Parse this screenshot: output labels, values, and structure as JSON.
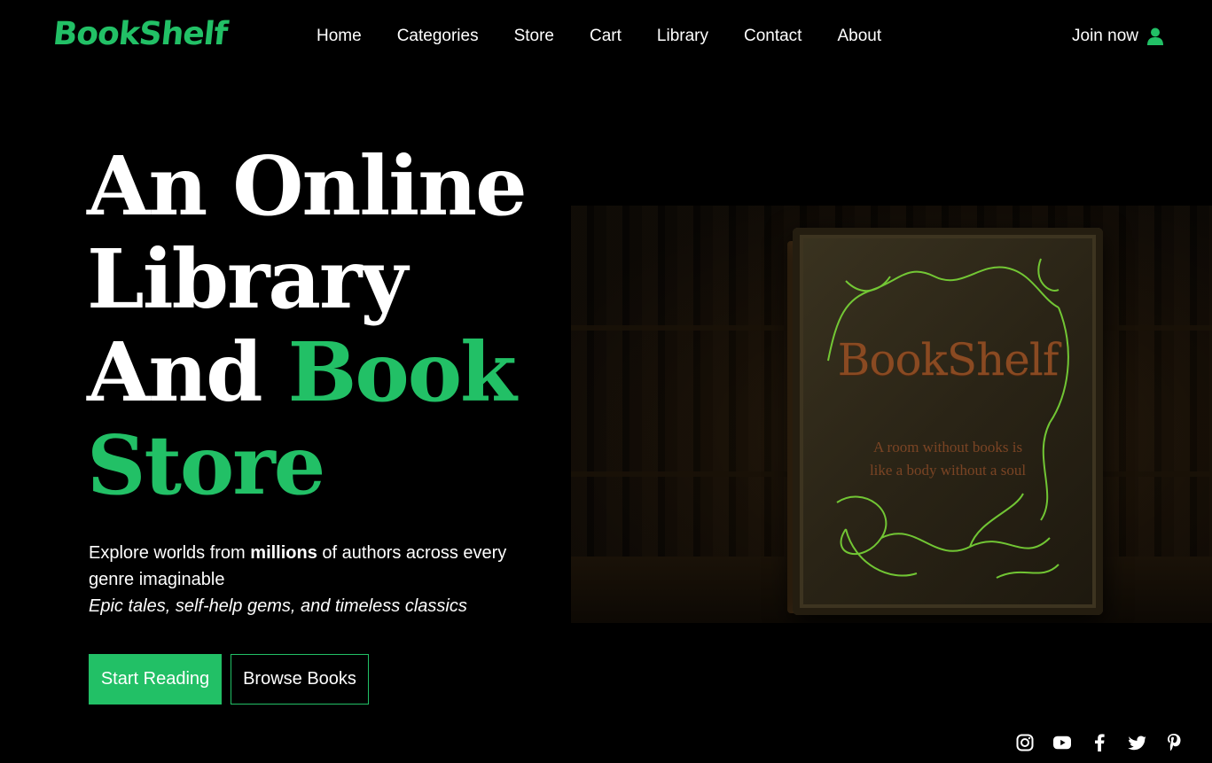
{
  "brand": {
    "name": "BookShelf",
    "accent_color": "#22c066"
  },
  "nav": {
    "items": [
      {
        "label": "Home"
      },
      {
        "label": "Categories"
      },
      {
        "label": "Store"
      },
      {
        "label": "Cart"
      },
      {
        "label": "Library"
      },
      {
        "label": "Contact"
      },
      {
        "label": "About"
      }
    ],
    "join_label": "Join now",
    "join_icon": "user-icon"
  },
  "hero": {
    "headline_line1": "An Online",
    "headline_line2": "Library",
    "headline_line3_white": "And ",
    "headline_line3_green": "Book",
    "headline_line4_green": "Store",
    "desc_prefix": "Explore worlds from ",
    "desc_bold": "millions",
    "desc_suffix": " of authors across every genre imaginable",
    "desc_italic": "Epic tales, self-help gems, and timeless classics",
    "primary_button": "Start Reading",
    "secondary_button": "Browse Books"
  },
  "hero_image": {
    "book_title": "BookShelf",
    "book_subtitle_line1": "A room without books is",
    "book_subtitle_line2": "like a body without a soul"
  },
  "social": [
    {
      "icon": "instagram-icon"
    },
    {
      "icon": "youtube-icon"
    },
    {
      "icon": "facebook-icon"
    },
    {
      "icon": "twitter-icon"
    },
    {
      "icon": "pinterest-icon"
    }
  ]
}
